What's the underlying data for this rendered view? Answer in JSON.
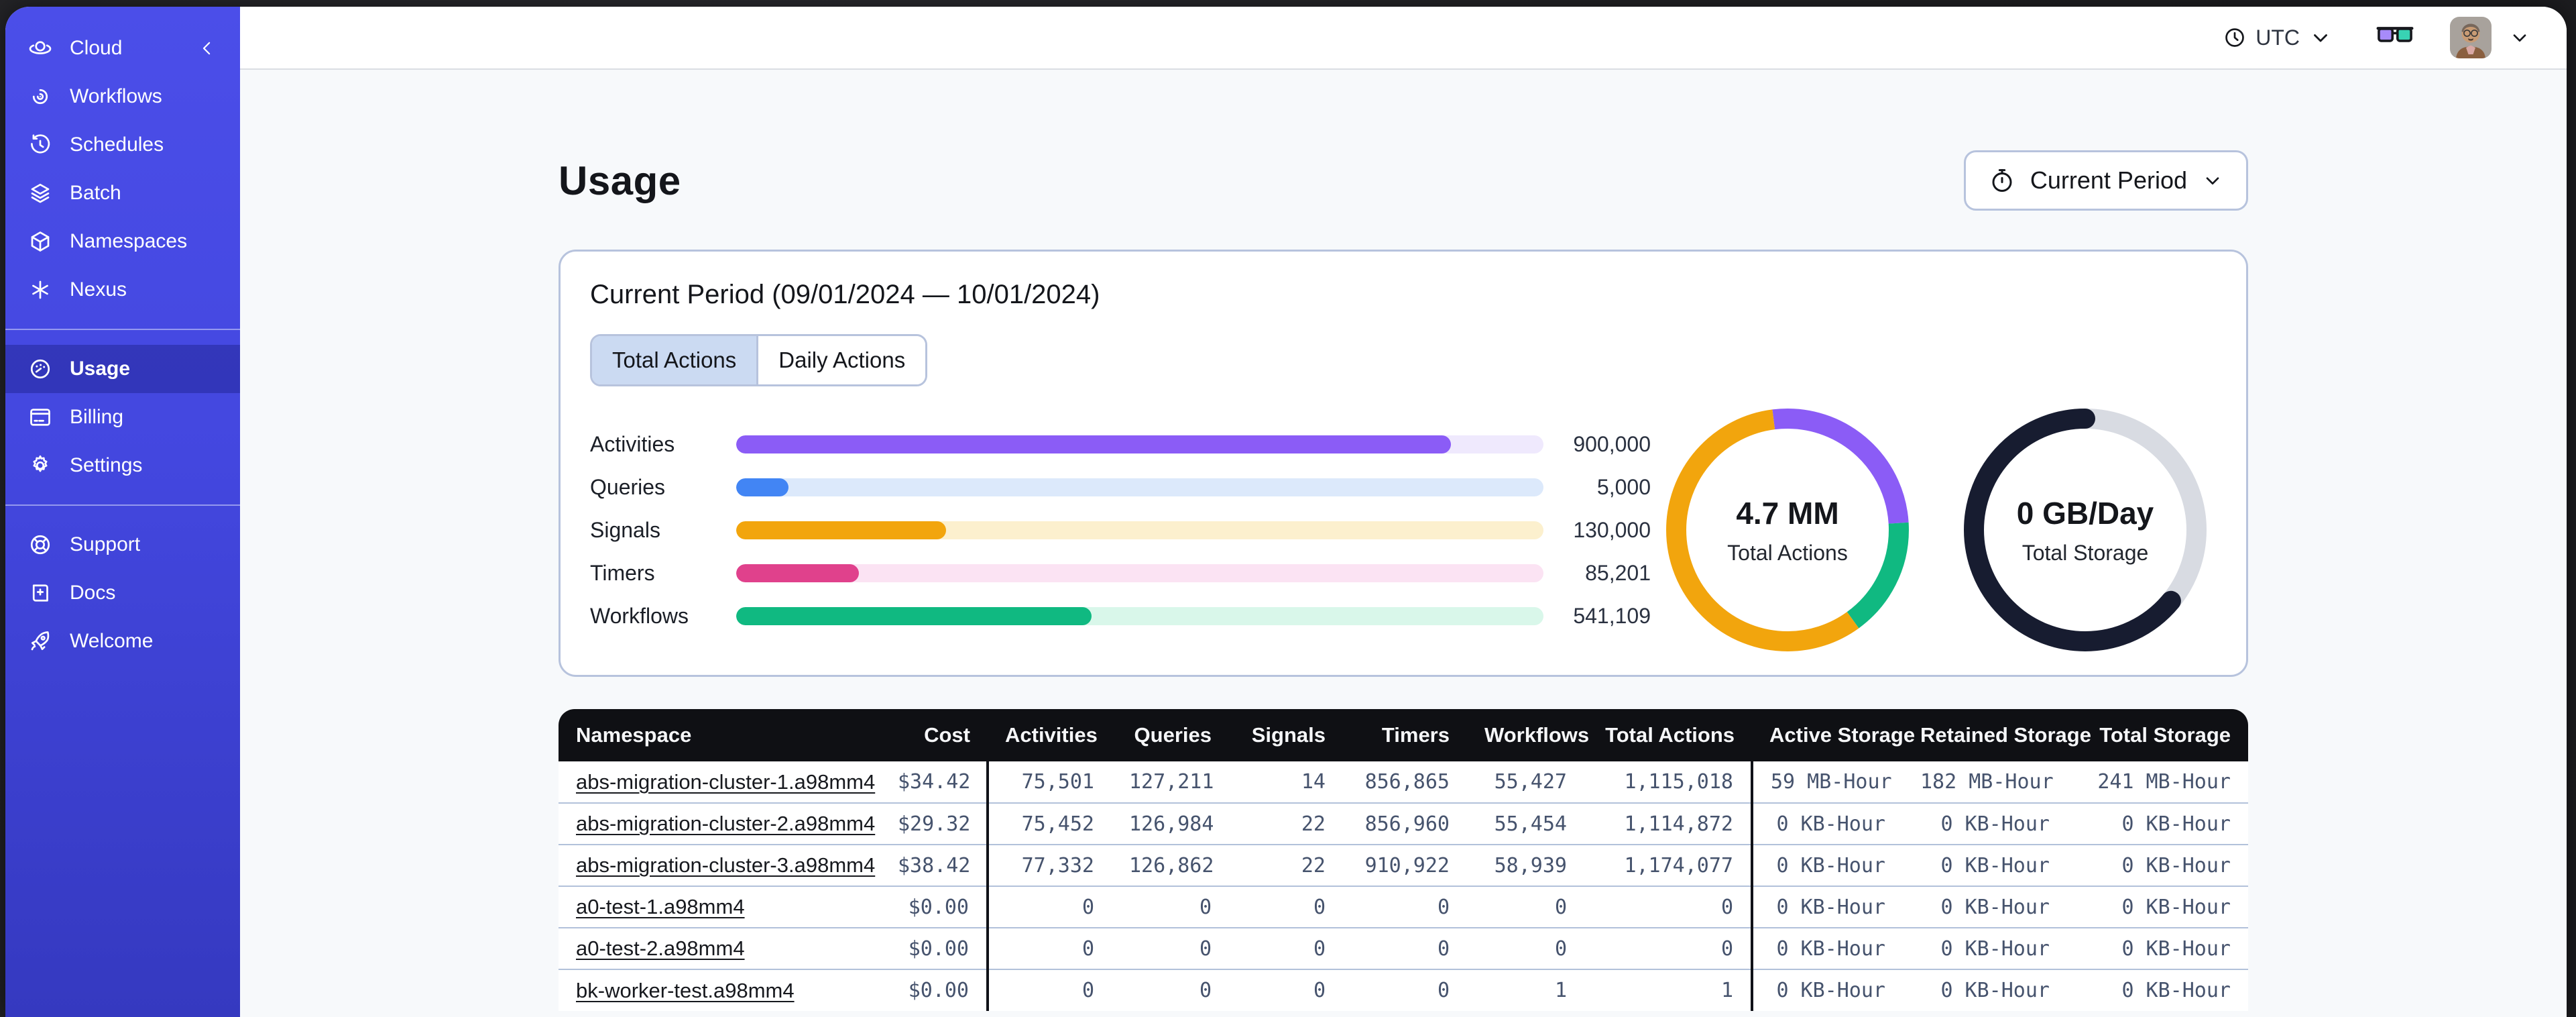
{
  "sidebar": {
    "sections": [
      {
        "items": [
          {
            "label": "Cloud",
            "icon": "cloud",
            "collapse_button": true
          },
          {
            "label": "Workflows",
            "icon": "workflows"
          },
          {
            "label": "Schedules",
            "icon": "schedules"
          },
          {
            "label": "Batch",
            "icon": "batch"
          },
          {
            "label": "Namespaces",
            "icon": "namespaces"
          },
          {
            "label": "Nexus",
            "icon": "nexus"
          }
        ]
      },
      {
        "items": [
          {
            "label": "Usage",
            "icon": "usage",
            "active": true
          },
          {
            "label": "Billing",
            "icon": "billing"
          },
          {
            "label": "Settings",
            "icon": "settings"
          }
        ]
      },
      {
        "items": [
          {
            "label": "Support",
            "icon": "support"
          },
          {
            "label": "Docs",
            "icon": "docs"
          },
          {
            "label": "Welcome",
            "icon": "welcome"
          }
        ]
      }
    ],
    "colors": {
      "background_top": "#4B4EE9",
      "background_bottom": "#3539C0"
    }
  },
  "topbar": {
    "timezone": "UTC"
  },
  "page": {
    "title": "Usage",
    "period_selector_label": "Current Period"
  },
  "usage_card": {
    "title": "Current Period (09/01/2024 — 10/01/2024)",
    "tabs": [
      {
        "label": "Total Actions",
        "active": true
      },
      {
        "label": "Daily Actions",
        "active": false
      }
    ]
  },
  "chart_data": [
    {
      "type": "bar",
      "orientation": "horizontal",
      "categories": [
        "Activities",
        "Queries",
        "Signals",
        "Timers",
        "Workflows"
      ],
      "values": [
        900000,
        5000,
        130000,
        85201,
        541109
      ],
      "value_labels": [
        "900,000",
        "5,000",
        "130,000",
        "85,201",
        "541,109"
      ],
      "fill_fractions": [
        0.885,
        0.065,
        0.26,
        0.152,
        0.44
      ],
      "bar_colors": [
        "#8B5CF6",
        "#4285F4",
        "#F2A50D",
        "#E0418C",
        "#10B981"
      ],
      "track_colors": [
        "#EFE9FD",
        "#DCE9FB",
        "#FCF0CE",
        "#FBE3F3",
        "#D9F7EA"
      ],
      "legend": "off",
      "grid": "off"
    },
    {
      "type": "donut",
      "center_value": "4.7 MM",
      "center_label": "Total Actions",
      "start_fraction": 0.98,
      "segments": [
        {
          "name": "activities",
          "color": "#8B5CF6",
          "fraction": 0.26
        },
        {
          "name": "workflows",
          "color": "#10B981",
          "fraction": 0.16
        },
        {
          "name": "signals",
          "color": "#F2A50D",
          "fraction": 0.58
        }
      ]
    },
    {
      "type": "donut",
      "center_value": "0 GB/Day",
      "center_label": "Total Storage",
      "start_fraction": 0,
      "segments": [
        {
          "name": "storage-remaining",
          "color": "#D8DBE2",
          "fraction": 0.36
        },
        {
          "name": "storage-used",
          "color": "#171C30",
          "fraction": 0.64,
          "cap": "round"
        }
      ]
    }
  ],
  "table": {
    "columns": [
      "Namespace",
      "Cost",
      "Activities",
      "Queries",
      "Signals",
      "Timers",
      "Workflows",
      "Total Actions",
      "Active Storage",
      "Retained Storage",
      "Total Storage"
    ],
    "rows": [
      [
        "abs-migration-cluster-1.a98mm4",
        "$34.42",
        "75,501",
        "127,211",
        "14",
        "856,865",
        "55,427",
        "1,115,018",
        "59 MB-Hour",
        "182 MB-Hour",
        "241 MB-Hour"
      ],
      [
        "abs-migration-cluster-2.a98mm4",
        "$29.32",
        "75,452",
        "126,984",
        "22",
        "856,960",
        "55,454",
        "1,114,872",
        "0 KB-Hour",
        "0 KB-Hour",
        "0 KB-Hour"
      ],
      [
        "abs-migration-cluster-3.a98mm4",
        "$38.42",
        "77,332",
        "126,862",
        "22",
        "910,922",
        "58,939",
        "1,174,077",
        "0 KB-Hour",
        "0 KB-Hour",
        "0 KB-Hour"
      ],
      [
        "a0-test-1.a98mm4",
        "$0.00",
        "0",
        "0",
        "0",
        "0",
        "0",
        "0",
        "0 KB-Hour",
        "0 KB-Hour",
        "0 KB-Hour"
      ],
      [
        "a0-test-2.a98mm4",
        "$0.00",
        "0",
        "0",
        "0",
        "0",
        "0",
        "0",
        "0 KB-Hour",
        "0 KB-Hour",
        "0 KB-Hour"
      ],
      [
        "bk-worker-test.a98mm4",
        "$0.00",
        "0",
        "0",
        "0",
        "0",
        "1",
        "1",
        "0 KB-Hour",
        "0 KB-Hour",
        "0 KB-Hour"
      ]
    ]
  }
}
